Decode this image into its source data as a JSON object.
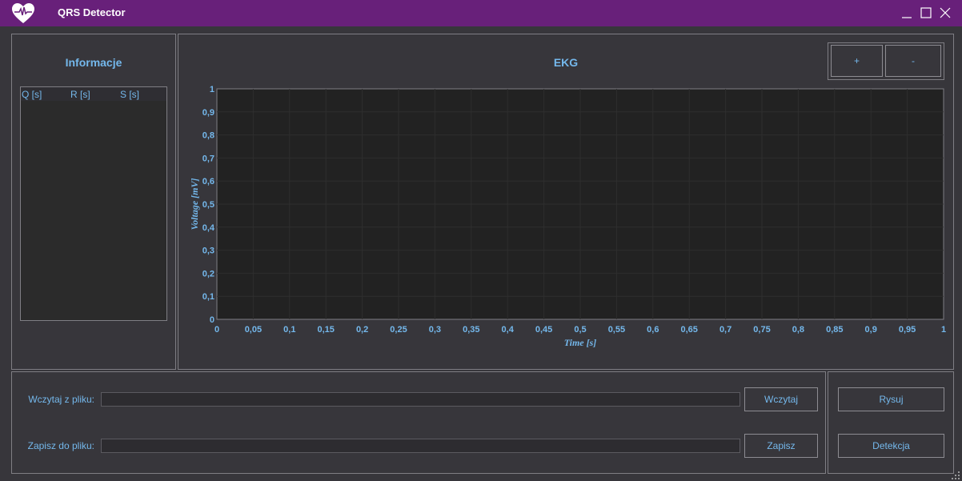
{
  "window": {
    "title": "QRS Detector",
    "logo_icon": "heart-pulse-icon",
    "controls": [
      "minimize-icon",
      "maximize-icon",
      "close-icon"
    ]
  },
  "info_panel": {
    "title": "Informacje",
    "columns": [
      "Q [s]",
      "R [s]",
      "S [s]"
    ],
    "rows": []
  },
  "chart_panel": {
    "title": "EKG",
    "zoom_in_label": "+",
    "zoom_out_label": "-"
  },
  "chart_data": {
    "type": "line",
    "title": "EKG",
    "xlabel": "Time [s]",
    "ylabel": "Voltage [mV]",
    "xlim": [
      0,
      1
    ],
    "ylim": [
      0,
      1
    ],
    "x_ticks": [
      "0",
      "0,05",
      "0,1",
      "0,15",
      "0,2",
      "0,25",
      "0,3",
      "0,35",
      "0,4",
      "0,45",
      "0,5",
      "0,55",
      "0,6",
      "0,65",
      "0,7",
      "0,75",
      "0,8",
      "0,85",
      "0,9",
      "0,95",
      "1"
    ],
    "y_ticks": [
      "0",
      "0,1",
      "0,2",
      "0,3",
      "0,4",
      "0,5",
      "0,6",
      "0,7",
      "0,8",
      "0,9",
      "1"
    ],
    "grid": true,
    "series": []
  },
  "file_panel": {
    "load_label": "Wczytaj z pliku:",
    "load_value": "",
    "load_button": "Wczytaj",
    "save_label": "Zapisz do pliku:",
    "save_value": "",
    "save_button": "Zapisz"
  },
  "actions": {
    "draw_button": "Rysuj",
    "detect_button": "Detekcja"
  },
  "colors": {
    "titlebar": "#68207a",
    "background": "#37363b",
    "plot_background": "#222222",
    "accent_text": "#74b8ec"
  }
}
